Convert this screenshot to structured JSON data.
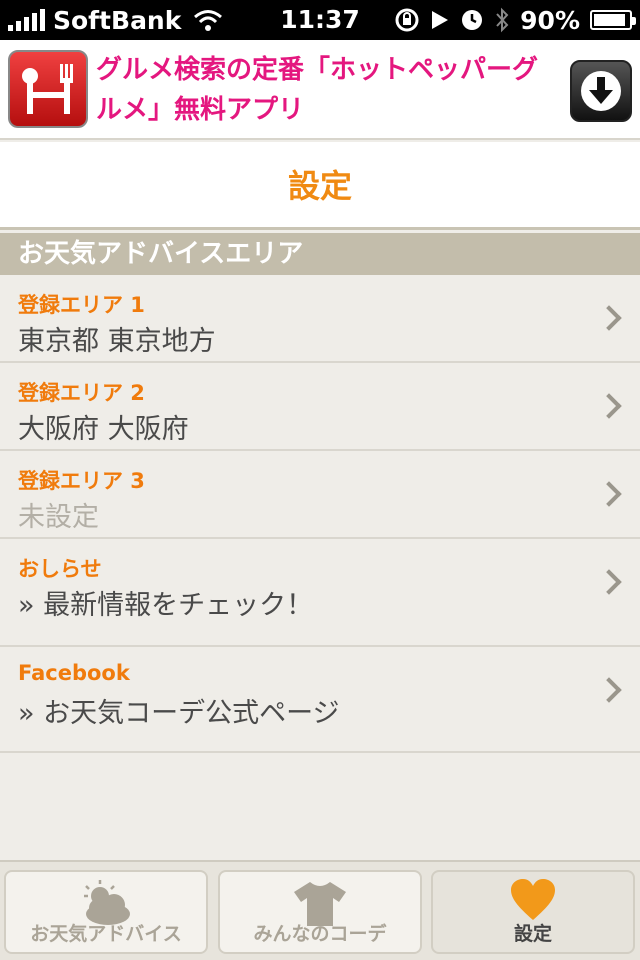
{
  "status_bar": {
    "carrier": "SoftBank",
    "time": "11:37",
    "battery_percent": "90%",
    "battery_level": 0.9,
    "icons": [
      "signal-icon",
      "wifi-icon",
      "rotation-lock-icon",
      "play-icon",
      "alarm-icon",
      "bluetooth-icon",
      "battery-icon"
    ]
  },
  "ad": {
    "text": "グルメ検索の定番「ホットペッパーグルメ」無料アプリ",
    "icons": [
      "fork-knife-icon",
      "download-icon"
    ],
    "colors": {
      "text": "#e4177f",
      "logo": "#d41c1c"
    }
  },
  "header": {
    "title": "設定",
    "color": "#f08a12"
  },
  "section": {
    "title": "お天気アドバイスエリア"
  },
  "rows": [
    {
      "label": "登録エリア 1",
      "value": "東京都 東京地方"
    },
    {
      "label": "登録エリア 2",
      "value": "大阪府 大阪府"
    },
    {
      "label": "登録エリア 3",
      "value": "未設定"
    },
    {
      "label": "おしらせ",
      "value": "» 最新情報をチェック！"
    },
    {
      "label": "Facebook",
      "value": "» お天気コーデ公式ページ"
    }
  ],
  "tabs": [
    {
      "label": "お天気アドバイス",
      "icon": "weather-icon"
    },
    {
      "label": "みんなのコーデ",
      "icon": "tshirt-icon"
    },
    {
      "label": "設定",
      "icon": "heart-icon"
    }
  ]
}
